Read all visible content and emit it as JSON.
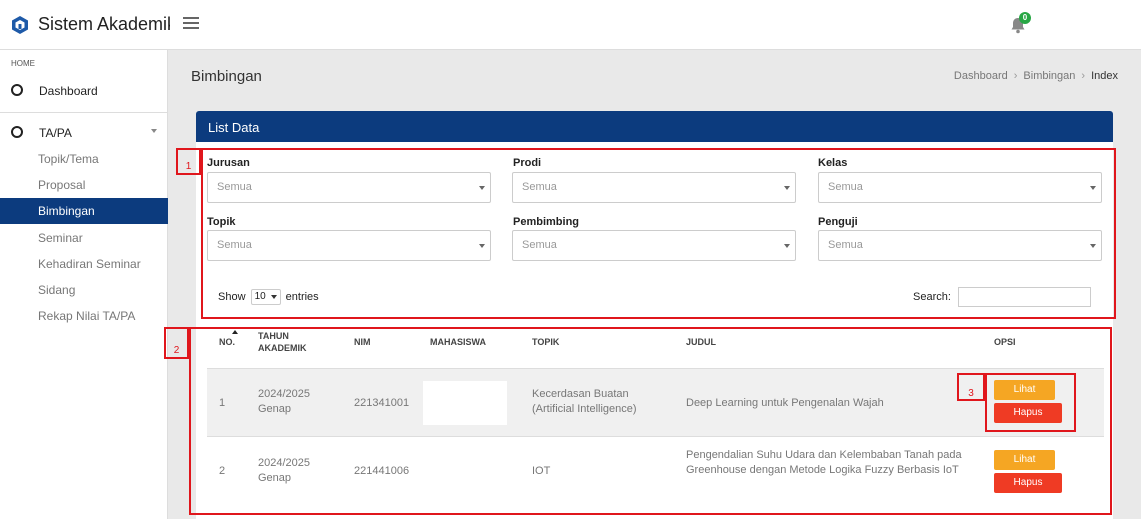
{
  "brand": {
    "title": "Sistem Akademik"
  },
  "notifications": {
    "count": "0"
  },
  "sidebar": {
    "header": "HOME",
    "main_items": [
      {
        "label": "Dashboard"
      },
      {
        "label": "TA/PA"
      }
    ],
    "sub_items": [
      {
        "label": "Topik/Tema"
      },
      {
        "label": "Proposal"
      },
      {
        "label": "Bimbingan"
      },
      {
        "label": "Seminar"
      },
      {
        "label": "Kehadiran Seminar"
      },
      {
        "label": "Sidang"
      },
      {
        "label": "Rekap Nilai TA/PA"
      }
    ]
  },
  "page": {
    "title": "Bimbingan",
    "breadcrumb": [
      "Dashboard",
      "Bimbingan",
      "Index"
    ]
  },
  "card": {
    "title": "List Data"
  },
  "filters": [
    {
      "label": "Jurusan",
      "value": "Semua"
    },
    {
      "label": "Prodi",
      "value": "Semua"
    },
    {
      "label": "Kelas",
      "value": "Semua"
    },
    {
      "label": "Topik",
      "value": "Semua"
    },
    {
      "label": "Pembimbing",
      "value": "Semua"
    },
    {
      "label": "Penguji",
      "value": "Semua"
    }
  ],
  "table_controls": {
    "show_label": "Show",
    "entries_value": "10",
    "entries_label": "entries",
    "search_label": "Search:"
  },
  "table": {
    "columns": [
      "NO.",
      "TAHUN AKADEMIK",
      "NIM",
      "MAHASISWA",
      "TOPIK",
      "JUDUL",
      "OPSI"
    ],
    "rows": [
      {
        "no": "1",
        "tahun": "2024/2025 Genap",
        "nim": "221341001",
        "mahasiswa": "",
        "topik": "Kecerdasan Buatan (Artificial Intelligence)",
        "judul": "Deep Learning untuk Pengenalan Wajah"
      },
      {
        "no": "2",
        "tahun": "2024/2025 Genap",
        "nim": "221441006",
        "mahasiswa": "",
        "topik": "IOT",
        "judul": "Pengendalian Suhu Udara dan Kelembaban Tanah pada Greenhouse dengan Metode Logika Fuzzy Berbasis IoT"
      }
    ],
    "buttons": {
      "view": "Lihat",
      "delete": "Hapus"
    }
  },
  "annotations": [
    "1",
    "2",
    "3"
  ],
  "colors": {
    "primary": "#0c3b7e",
    "view_button": "#f5a623",
    "delete_button": "#ef3b24",
    "annotation": "#e0161c",
    "badge": "#28a745"
  }
}
